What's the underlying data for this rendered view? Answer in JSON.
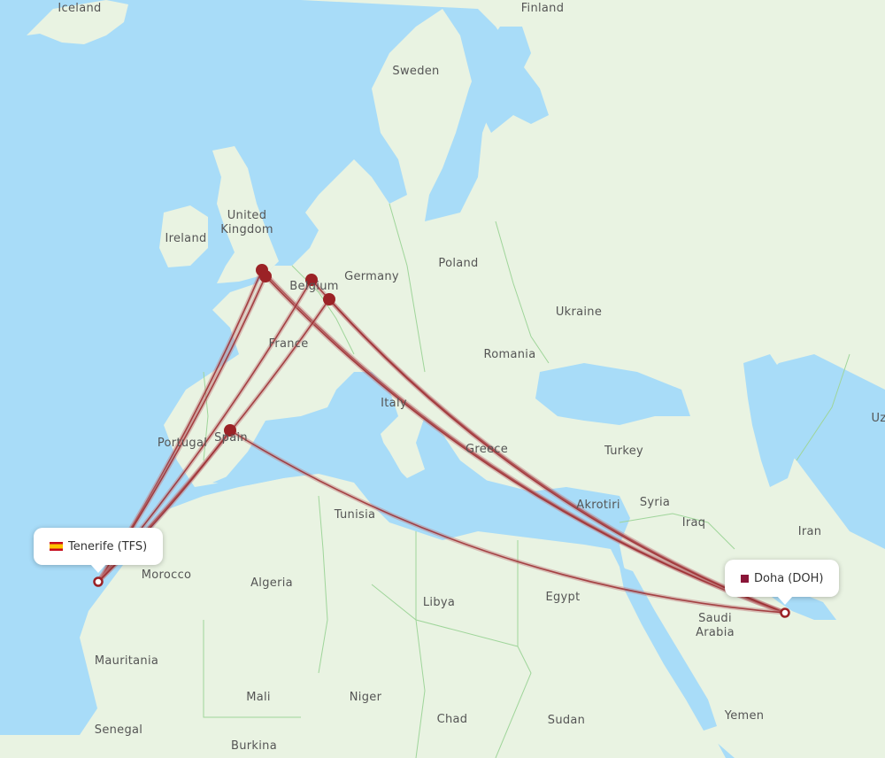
{
  "colors": {
    "water": "#a8dcf8",
    "land": "#e9f3e2",
    "border": "#9fd59a",
    "route": "#9b2a2e",
    "route_light": "#c07b7d",
    "airport": "#9b2226"
  },
  "country_labels": [
    {
      "name": "Iceland"
    },
    {
      "name": "Finland"
    },
    {
      "name": "Sweden"
    },
    {
      "name": "United Kingdom"
    },
    {
      "name": "Ireland"
    },
    {
      "name": "Poland"
    },
    {
      "name": "Germany"
    },
    {
      "name": "Belgium"
    },
    {
      "name": "Ukraine"
    },
    {
      "name": "France"
    },
    {
      "name": "Romania"
    },
    {
      "name": "Italy"
    },
    {
      "name": "Portugal"
    },
    {
      "name": "Spain"
    },
    {
      "name": "Greece"
    },
    {
      "name": "Turkey"
    },
    {
      "name": "Tunisia"
    },
    {
      "name": "Akrotiri"
    },
    {
      "name": "Syria"
    },
    {
      "name": "Iraq"
    },
    {
      "name": "Iran"
    },
    {
      "name": "Uz"
    },
    {
      "name": "Morocco"
    },
    {
      "name": "Algeria"
    },
    {
      "name": "Libya"
    },
    {
      "name": "Egypt"
    },
    {
      "name": "Saudi Arabia"
    },
    {
      "name": "Mauritania"
    },
    {
      "name": "Mali"
    },
    {
      "name": "Niger"
    },
    {
      "name": "Chad"
    },
    {
      "name": "Sudan"
    },
    {
      "name": "Yemen"
    },
    {
      "name": "Senegal"
    },
    {
      "name": "Burkina"
    }
  ],
  "origin": {
    "name": "Tenerife",
    "code": "TFS",
    "label": "Tenerife (TFS)",
    "flag": "spain-flag"
  },
  "destination": {
    "name": "Doha",
    "code": "DOH",
    "label": "Doha (DOH)",
    "flag": "qatar-flag"
  },
  "stopovers": [
    {
      "id": "london-a",
      "region": "United Kingdom"
    },
    {
      "id": "london-b",
      "region": "United Kingdom"
    },
    {
      "id": "brussels",
      "region": "Belgium"
    },
    {
      "id": "luxembourg",
      "region": "Belgium"
    },
    {
      "id": "madrid",
      "region": "Spain"
    }
  ],
  "routes": [
    {
      "from": "TFS",
      "via": "london-a",
      "to": "DOH"
    },
    {
      "from": "TFS",
      "via": "london-b",
      "to": "DOH"
    },
    {
      "from": "TFS",
      "via": "brussels",
      "to": "DOH"
    },
    {
      "from": "TFS",
      "via": "luxembourg",
      "to": "DOH"
    },
    {
      "from": "TFS",
      "via": "madrid",
      "to": "DOH"
    }
  ]
}
